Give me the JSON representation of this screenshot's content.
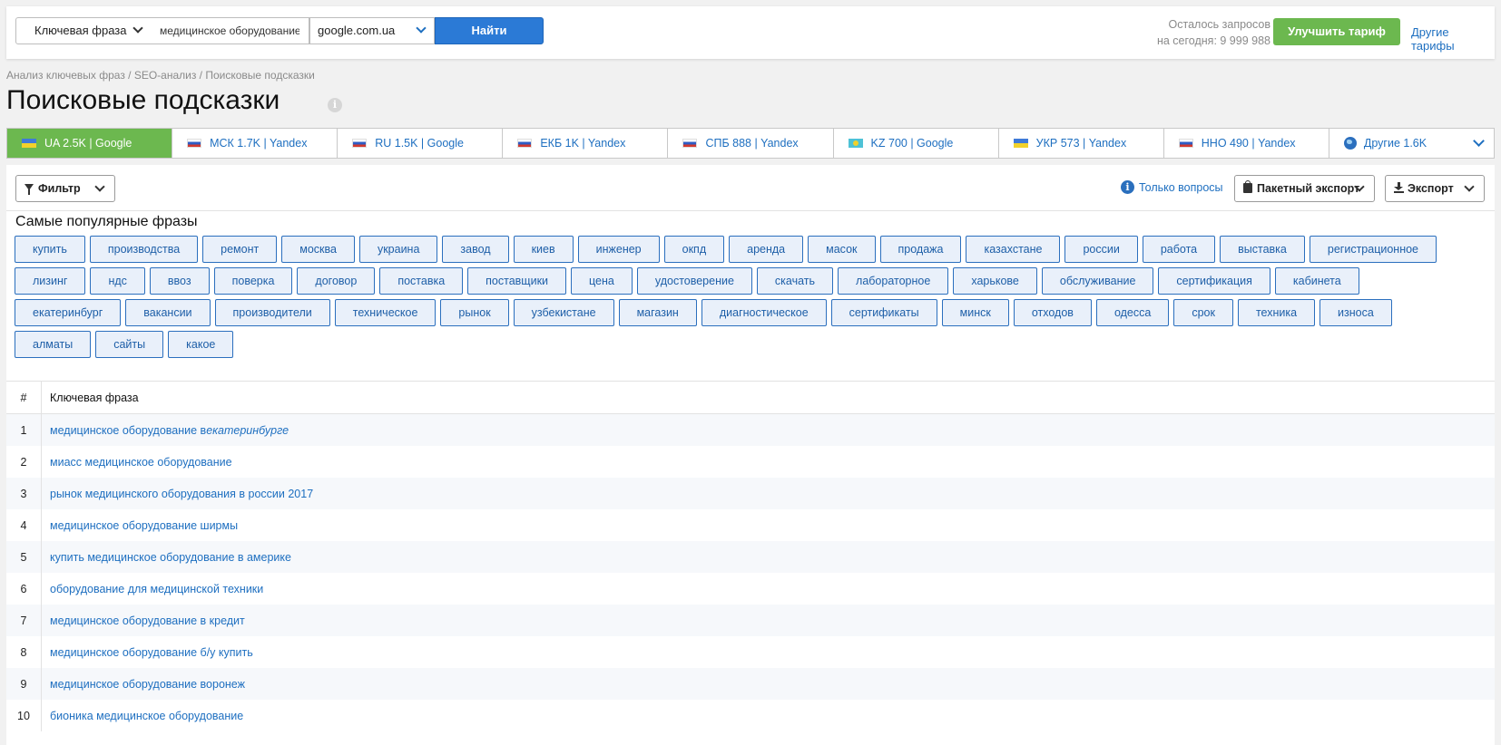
{
  "search": {
    "mode_label": "Ключевая фраза",
    "query_value": "медицинское оборудование",
    "domain_label": "google.com.ua",
    "submit_label": "Найти",
    "quota_line1": "Осталось запросов",
    "quota_line2": "на сегодня: 9 999 988",
    "upgrade_label": "Улучшить тариф",
    "other_plans_label": "Другие тарифы"
  },
  "breadcrumb": "Анализ ключевых фраз / SEO-анализ / Поисковые подсказки",
  "page_title": "Поисковые подсказки",
  "region_tabs": [
    {
      "label": "UA 2.5K | Google",
      "flag": "ua",
      "active": true
    },
    {
      "label": "МСК 1.7K | Yandex",
      "flag": "ru"
    },
    {
      "label": "RU 1.5K | Google",
      "flag": "ru"
    },
    {
      "label": "ЕКБ 1K | Yandex",
      "flag": "ru"
    },
    {
      "label": "СПБ 888 | Yandex",
      "flag": "ru"
    },
    {
      "label": "KZ 700 | Google",
      "flag": "kz"
    },
    {
      "label": "УКР 573 | Yandex",
      "flag": "ua"
    },
    {
      "label": "ННО 490 | Yandex",
      "flag": "ru"
    },
    {
      "label": "Другие 1.6K",
      "flag": "globe-icon"
    }
  ],
  "toolbar": {
    "filter_label": "Фильтр",
    "questions_only_label": "Только вопросы",
    "batch_export_label": "Пакетный экспорт",
    "export_label": "Экспорт"
  },
  "popular": {
    "title": "Самые популярные фразы",
    "chips": [
      "купить",
      "производства",
      "ремонт",
      "москва",
      "украина",
      "завод",
      "киев",
      "инженер",
      "окпд",
      "аренда",
      "масок",
      "продажа",
      "казахстане",
      "россии",
      "работа",
      "выставка",
      "регистрационное",
      "лизинг",
      "ндс",
      "ввоз",
      "поверка",
      "договор",
      "поставка",
      "поставщики",
      "цена",
      "удостоверение",
      "скачать",
      "лабораторное",
      "харькове",
      "обслуживание",
      "сертификация",
      "кабинета",
      "екатеринбург",
      "вакансии",
      "производители",
      "техническое",
      "рынок",
      "узбекистане",
      "магазин",
      "диагностическое",
      "сертификаты",
      "минск",
      "отходов",
      "одесса",
      "срок",
      "техника",
      "износа",
      "алматы",
      "сайты",
      "какое"
    ]
  },
  "table": {
    "col_num": "#",
    "col_phrase": "Ключевая фраза",
    "rows": [
      {
        "num": "1",
        "phrase": "медицинское оборудование в ",
        "highlight": "екатеринбурге"
      },
      {
        "num": "2",
        "phrase": "миасс медицинское оборудование"
      },
      {
        "num": "3",
        "phrase": "рынок медицинского оборудования в россии 2017"
      },
      {
        "num": "4",
        "phrase": "медицинское оборудование ширмы"
      },
      {
        "num": "5",
        "phrase": "купить медицинское оборудование в америке"
      },
      {
        "num": "6",
        "phrase": "оборудование для медицинской техники"
      },
      {
        "num": "7",
        "phrase": "медицинское оборудование в кредит"
      },
      {
        "num": "8",
        "phrase": "медицинское оборудование б/у купить"
      },
      {
        "num": "9",
        "phrase": "медицинское оборудование воронеж"
      },
      {
        "num": "10",
        "phrase": "бионика медицинское оборудование"
      }
    ]
  },
  "colors": {
    "accent_blue": "#2b7ad6",
    "link_blue": "#1e6fc0",
    "green": "#6cb84f",
    "chip_bg": "#e9f0fa"
  }
}
